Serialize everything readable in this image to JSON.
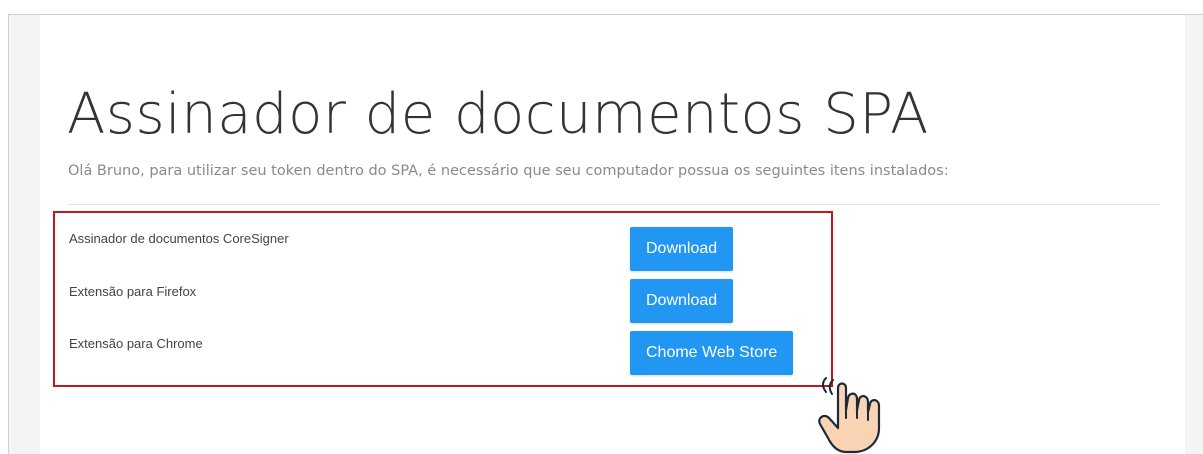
{
  "page": {
    "title": "Assinador de documentos SPA",
    "intro": "Olá Bruno, para utilizar seu token dentro do SPA, é necessário que seu computador possua os seguintes itens instalados:"
  },
  "items": [
    {
      "label": "Assinador de documentos CoreSigner",
      "button_label": "Download"
    },
    {
      "label": "Extensão para Firefox",
      "button_label": "Download"
    },
    {
      "label": "Extensão para Chrome",
      "button_label": "Chome Web Store"
    }
  ],
  "colors": {
    "button": "#2196f3",
    "highlight_border": "#c4161c",
    "hand_fill": "#f9d3b4",
    "hand_outline": "#1a2a3a"
  },
  "icons": {
    "pointer": "pointing-hand-icon"
  }
}
